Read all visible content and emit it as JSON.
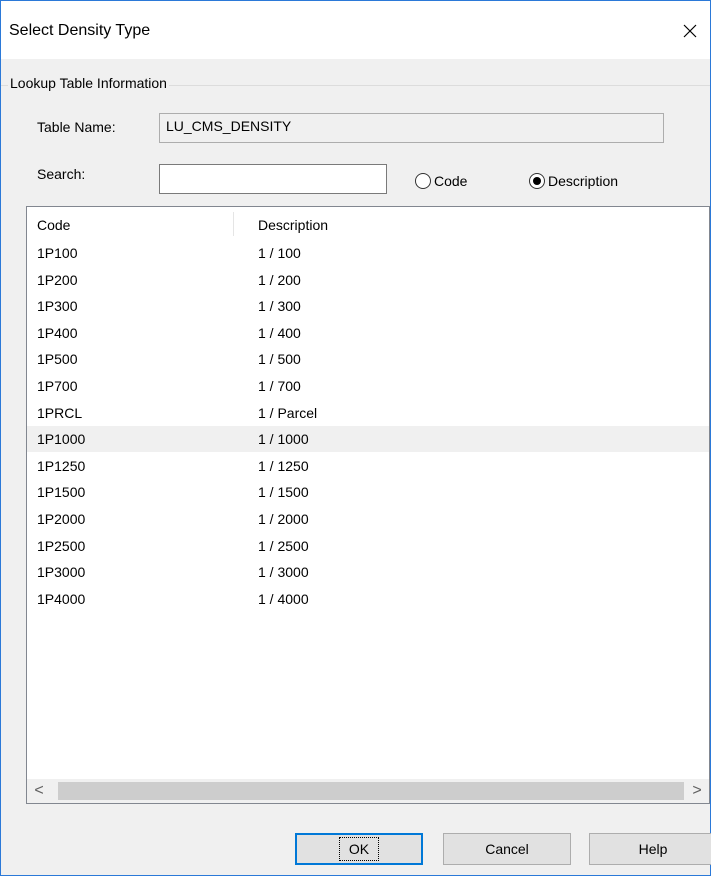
{
  "window": {
    "title": "Select Density Type"
  },
  "group": {
    "legend": "Lookup Table Information"
  },
  "table_name": {
    "label": "Table Name:",
    "value": "LU_CMS_DENSITY"
  },
  "search": {
    "label": "Search:",
    "value": "",
    "placeholder": ""
  },
  "search_by": {
    "options": [
      {
        "label": "Code",
        "checked": false
      },
      {
        "label": "Description",
        "checked": true
      }
    ]
  },
  "list": {
    "columns": [
      "Code",
      "Description"
    ],
    "selected_index": 7,
    "rows": [
      {
        "code": "1P100",
        "description": "1 / 100"
      },
      {
        "code": "1P200",
        "description": "1 / 200"
      },
      {
        "code": "1P300",
        "description": "1 / 300"
      },
      {
        "code": "1P400",
        "description": "1 / 400"
      },
      {
        "code": "1P500",
        "description": "1 / 500"
      },
      {
        "code": "1P700",
        "description": "1 / 700"
      },
      {
        "code": "1PRCL",
        "description": "1 / Parcel"
      },
      {
        "code": "1P1000",
        "description": "1 / 1000"
      },
      {
        "code": "1P1250",
        "description": "1 / 1250"
      },
      {
        "code": "1P1500",
        "description": "1 / 1500"
      },
      {
        "code": "1P2000",
        "description": "1 / 2000"
      },
      {
        "code": "1P2500",
        "description": "1 / 2500"
      },
      {
        "code": "1P3000",
        "description": "1 / 3000"
      },
      {
        "code": "1P4000",
        "description": "1 / 4000"
      }
    ]
  },
  "scrollbar": {
    "left_icon": "chevron-left-icon",
    "right_icon": "chevron-right-icon",
    "left_glyph": "<",
    "right_glyph": ">"
  },
  "buttons": {
    "ok": "OK",
    "cancel": "Cancel",
    "help": "Help"
  },
  "colors": {
    "accent": "#0078d7",
    "window_border": "#2b79d8",
    "selected_row": "#f0f0f0"
  }
}
